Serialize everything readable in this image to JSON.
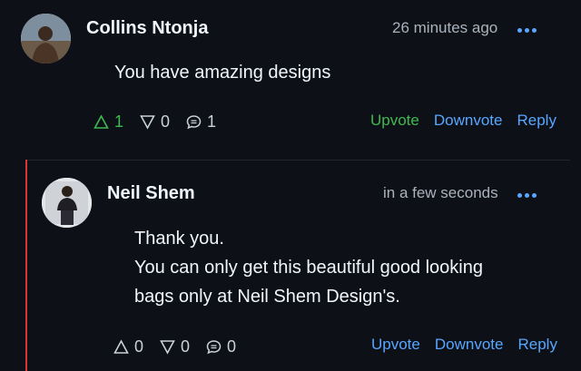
{
  "comments": [
    {
      "author": "Collins Ntonja",
      "time": "26 minutes ago",
      "body_lines": [
        "You have amazing designs"
      ],
      "upvotes": "1",
      "downvotes": "0",
      "replies": "1",
      "actions": {
        "upvote": "Upvote",
        "downvote": "Downvote",
        "reply": "Reply"
      },
      "upvote_active": true
    },
    {
      "author": "Neil Shem",
      "time": "in a few seconds",
      "body_lines": [
        "Thank you.",
        "You can only get this beautiful good looking",
        "bags only at Neil Shem Design's."
      ],
      "upvotes": "0",
      "downvotes": "0",
      "replies": "0",
      "actions": {
        "upvote": "Upvote",
        "downvote": "Downvote",
        "reply": "Reply"
      },
      "upvote_active": false
    }
  ],
  "icons": {
    "upvote": "triangle-up-icon",
    "downvote": "triangle-down-icon",
    "replies": "speech-bubble-icon",
    "more": "more-horizontal-icon"
  },
  "colors": {
    "background": "#0d1117",
    "accent": "#58a6ff",
    "upvote_active": "#3fb950",
    "reply_thread_border": "#da3633"
  }
}
